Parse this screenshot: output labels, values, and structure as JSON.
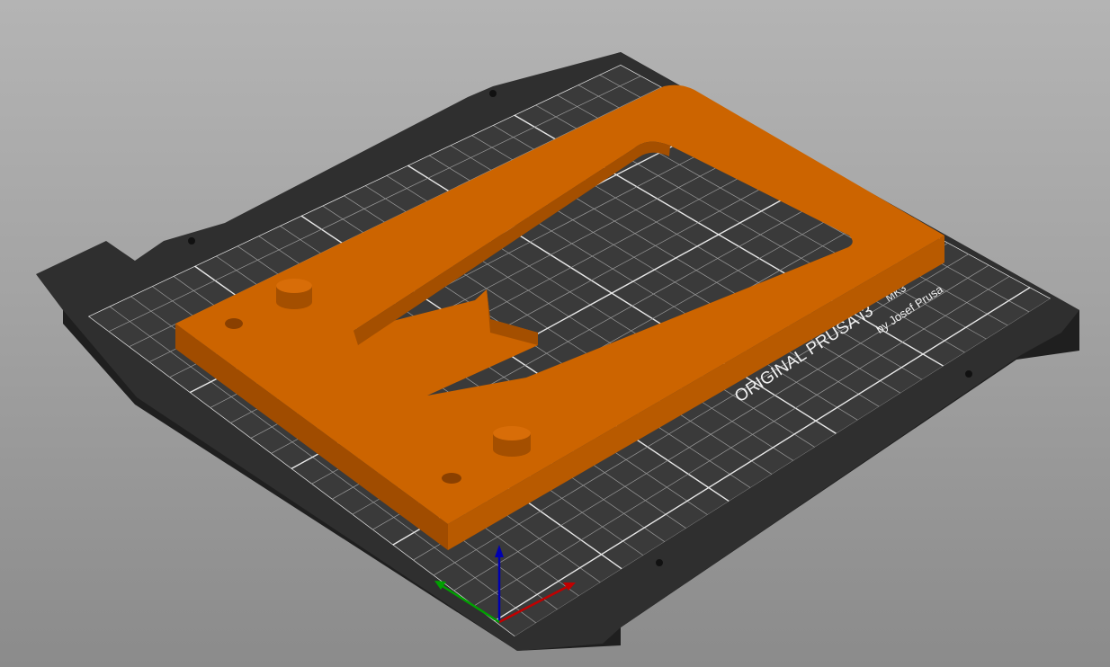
{
  "bed": {
    "logo_main": "ORIGINAL PRUSA i3",
    "logo_model": "MK3",
    "logo_sub": "by Josef Prusa"
  },
  "colors": {
    "background_top": "#b4b4b4",
    "background_bottom": "#8b8b8b",
    "bed_sheet": "#2e2e2e",
    "bed_grid": "#e8e8e8",
    "model": "#cc6400",
    "model_side": "#a84f00",
    "axis_x": "#c00000",
    "axis_y": "#00a000",
    "axis_z": "#0000b0"
  },
  "icons": {
    "axis_gizmo": "xyz-axes-icon"
  }
}
